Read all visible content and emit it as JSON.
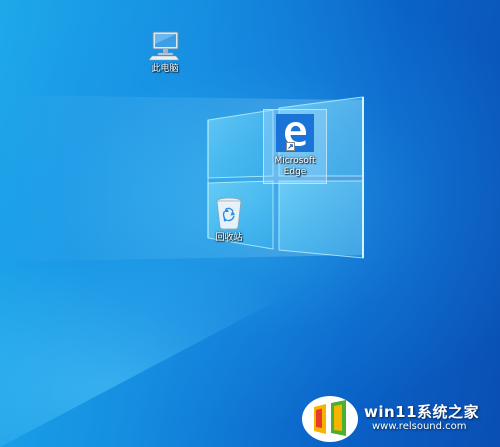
{
  "desktop": {
    "wallpaper": "windows-10-hero-light",
    "colors": {
      "background_light": "#1ea8ea",
      "background_dark": "#0a4fb3",
      "window_glow": "#6fdcff"
    },
    "icons": [
      {
        "label": "此电脑",
        "icon": "computer-icon"
      },
      {
        "label": "Microsoft\nEdge",
        "icon": "edge-icon",
        "selected": true,
        "shortcut": true
      },
      {
        "label": "回收站",
        "icon": "recycle-bin-icon"
      }
    ]
  },
  "watermark": {
    "title": "win11系统之家",
    "url": "www.relsound.com",
    "colors": {
      "logo_yellow": "#f5b400",
      "logo_red": "#e63a2a",
      "logo_green": "#4caf2f",
      "logo_bg": "#ffffff"
    }
  }
}
